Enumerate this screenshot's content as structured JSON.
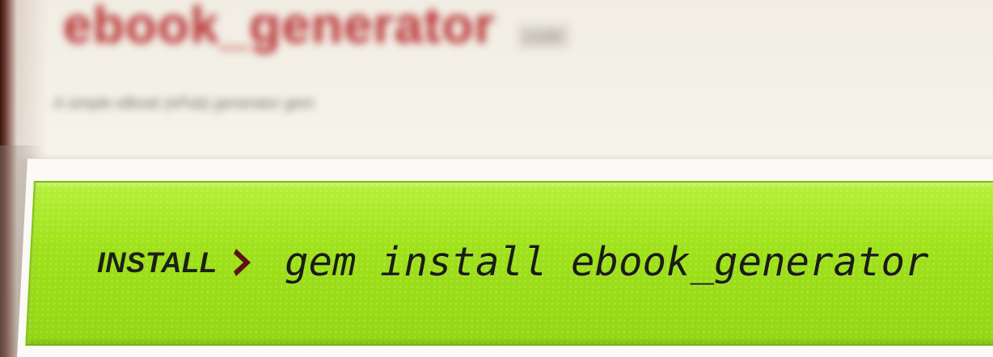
{
  "header": {
    "repo_name": "ebook_generator",
    "badge": "code",
    "description": "A simple eBook (ePub) generator gem"
  },
  "install": {
    "label": "INSTALL",
    "chevron_icon": "chevron-right-icon",
    "command": "gem install ebook_generator"
  },
  "colors": {
    "install_bar": "#9fe21c",
    "repo_name": "#b83234",
    "chevron": "#5a1512"
  }
}
